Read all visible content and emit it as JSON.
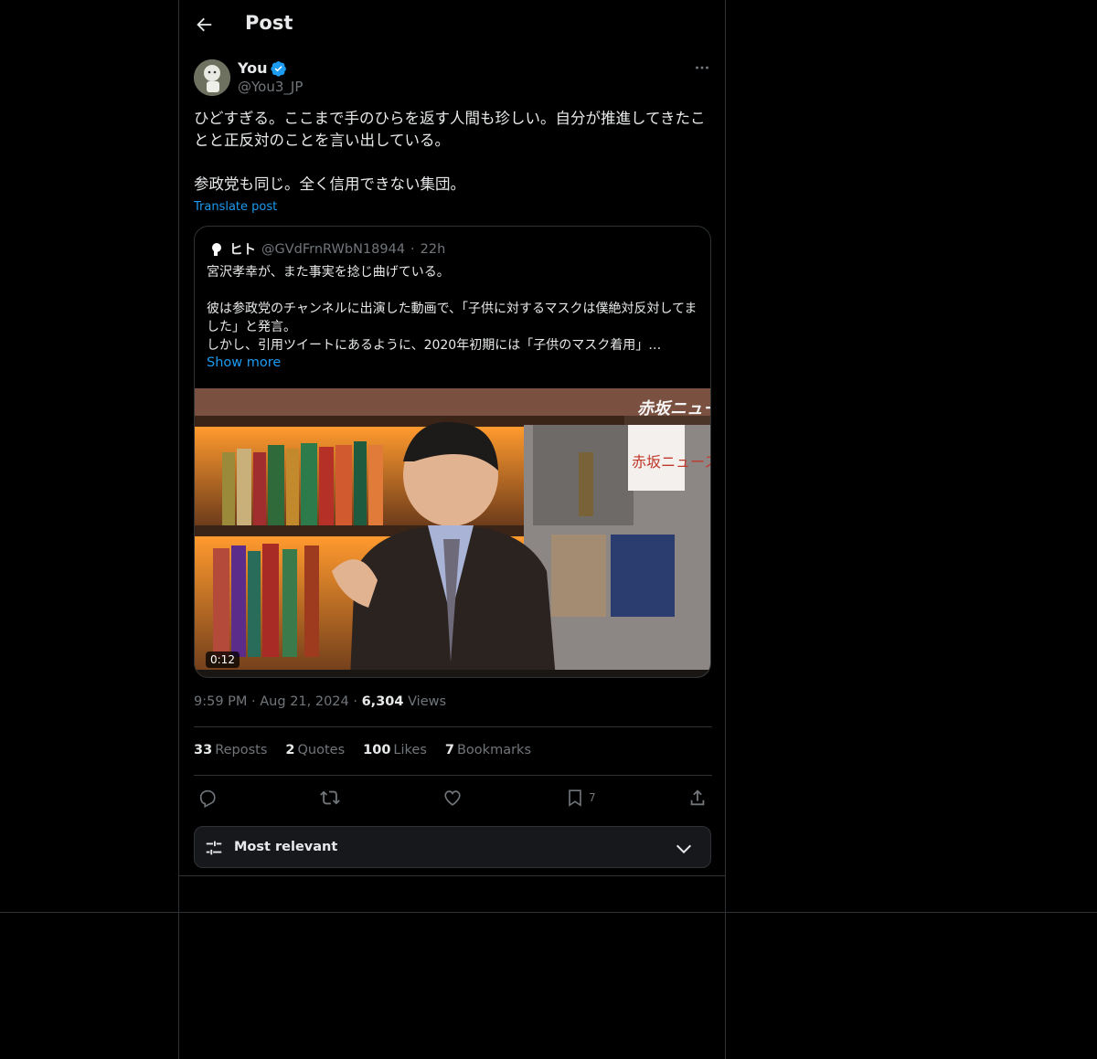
{
  "header": {
    "title": "Post"
  },
  "post": {
    "author_name": "You",
    "author_handle": "@You3_JP",
    "text": "ひどすぎる。ここまで手のひらを返す人間も珍しい。自分が推進してきたことと正反対のことを言い出している。\n\n参政党も同じ。全く信用できない集団。",
    "translate_label": "Translate post",
    "time": "9:59 PM",
    "date": "Aug 21, 2024",
    "views_count": "6,304",
    "views_label": "Views"
  },
  "quote": {
    "author_name": "ヒト",
    "author_handle": "@GVdFrnRWbN18944",
    "time": "22h",
    "text": "宮沢孝幸が、また事実を捻じ曲げている。\n\n彼は参政党のチャンネルに出演した動画で、「子供に対するマスクは僕絶対反対してました」と発言。\nしかし、引用ツイートにあるように、2020年初期には「子供のマスク着用」…",
    "show_more": "Show more",
    "video_duration": "0:12",
    "video_watermark": "赤坂ニュース"
  },
  "stats": {
    "reposts_count": "33",
    "reposts_label": "Reposts",
    "quotes_count": "2",
    "quotes_label": "Quotes",
    "likes_count": "100",
    "likes_label": "Likes",
    "bookmarks_count": "7",
    "bookmarks_label": "Bookmarks"
  },
  "actions": {
    "bookmark_count": "7"
  },
  "sort": {
    "label": "Most relevant"
  },
  "icons": {
    "back": "arrow-left-icon",
    "verified": "verified-badge-icon",
    "more": "more-horizontal-icon",
    "reply": "reply-icon",
    "repost": "repost-icon",
    "like": "heart-icon",
    "bookmark": "bookmark-icon",
    "share": "share-icon",
    "sort": "sliders-icon",
    "chevron": "chevron-down-icon"
  },
  "colors": {
    "background": "#000000",
    "text": "#e7e9ea",
    "muted": "#71767b",
    "accent": "#1d9bf0",
    "border": "#2f3336"
  }
}
